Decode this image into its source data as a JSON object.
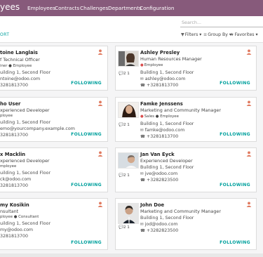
{
  "app": {
    "title_fragment": "yees",
    "menu": [
      "Employees",
      "Contracts",
      "Challenges",
      "Departments",
      "Configuration"
    ]
  },
  "control_panel": {
    "search_placeholder": "Search...",
    "import_label": "ORT",
    "filters_label": "Filters",
    "groupby_label": "Group By",
    "favorites_label": "Favorites"
  },
  "follow_label": "FOLLOWING",
  "left_cards": [
    {
      "name": "toine Langlais",
      "job": "f Technical Officer",
      "tags": "iner ● Employee",
      "address": "uilding 1, Second Floor",
      "email": "ntoine@odoo.com",
      "phone": "3281813700"
    },
    {
      "name": "ho User",
      "job": "xperienced Developer",
      "tags": "ployee",
      "address": "uilding 1, Second Floor",
      "email": "emo@yourcompany.example.com",
      "phone": "3281813700"
    },
    {
      "name": "x Macklin",
      "job": "xperienced Developer",
      "tags": "mployee",
      "address": "uilding 1, Second Floor",
      "email": "ck@odoo.com",
      "phone": "3281813700"
    },
    {
      "name": "my Kosikin",
      "job": "nsultant",
      "tags": "ployee ● Consultant",
      "address": "uilding 1, Second Floor",
      "email": "my@odoo.com",
      "phone": "3281813700"
    }
  ],
  "right_cards": [
    {
      "name": "Ashley Presley",
      "job": "Human Resources Manager",
      "tags": "Employee",
      "address": "Building 1, Second Floor",
      "email": "ashley@odoo.com",
      "phone": "+3281813700",
      "stats": "2  1"
    },
    {
      "name": "Famke Jenssens",
      "job": "Marketing and Community Manager",
      "tags": "Sales ● Employee",
      "address": "Building 1, Second Floor",
      "email": "famke@odoo.com",
      "phone": "+3281813700",
      "stats": "2  1"
    },
    {
      "name": "Jan Van Eyck",
      "job": "Experienced Developer",
      "tags": "",
      "address": "Building 1, Second Floor",
      "email": "jve@odoo.com",
      "phone": "+3282823500",
      "stats": "2  1"
    },
    {
      "name": "John Doe",
      "job": "Marketing and Community Manager",
      "tags": "",
      "address": "Building 1, Second Floor",
      "email": "jod@odoo.com",
      "phone": "+3282823500",
      "stats": "2  1"
    }
  ],
  "colors": {
    "navbar": "#875a7b",
    "accent": "#00a09d",
    "user_icon": "#e07a5f"
  }
}
